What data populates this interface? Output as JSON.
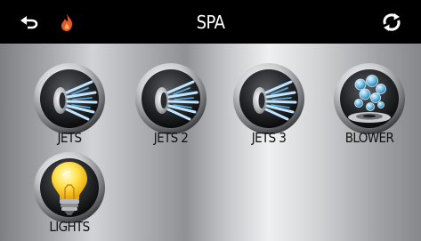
{
  "header": {
    "title": "SPA",
    "back_icon": "back-arrow-icon",
    "heat_icon": "flame-icon",
    "refresh_icon": "rotate-arrows-icon",
    "colors": {
      "bar": "#000000",
      "title": "#ffffff",
      "flame": "#e4572e"
    }
  },
  "tiles": [
    {
      "label": "JETS",
      "icon": "jets-icon"
    },
    {
      "label": "JETS 2",
      "icon": "jets-icon"
    },
    {
      "label": "JETS 3",
      "icon": "jets-icon"
    },
    {
      "label": "BLOWER",
      "icon": "blower-bubbles-icon"
    },
    {
      "label": "LIGHTS",
      "icon": "light-bulb-icon"
    }
  ]
}
